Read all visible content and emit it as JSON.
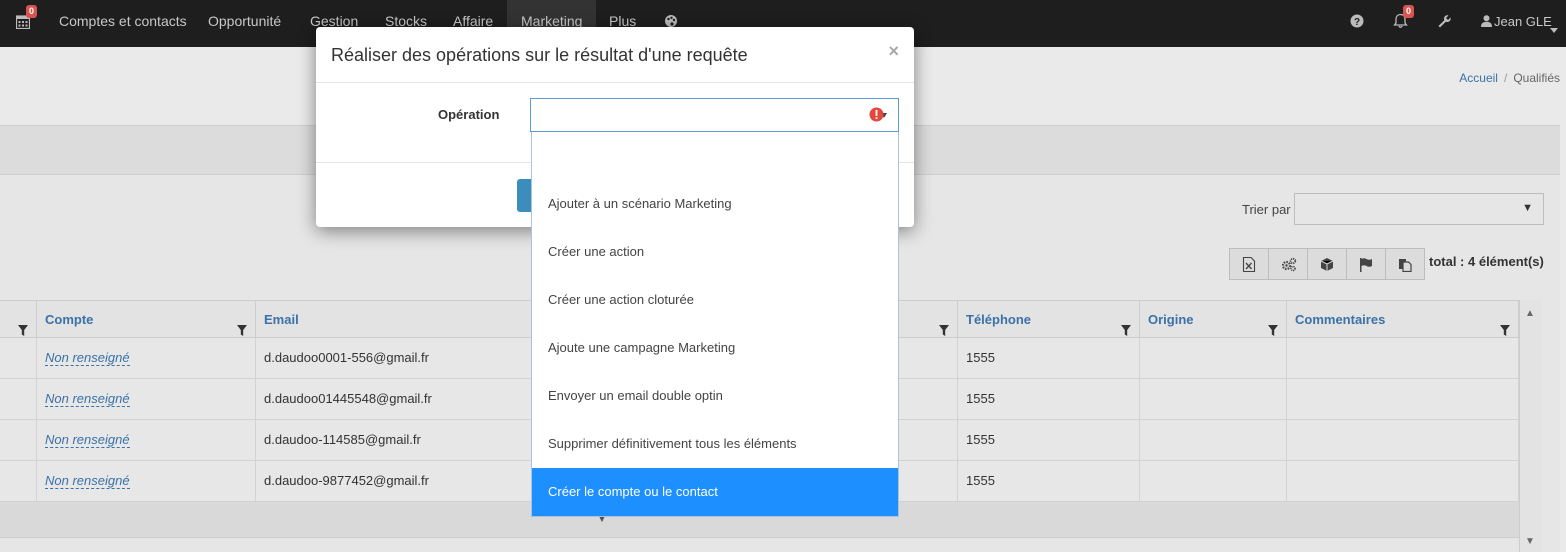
{
  "nav": {
    "calendar_badge": "0",
    "items": [
      "Comptes et contacts",
      "Opportunité",
      "Gestion",
      "Stocks",
      "Affaire",
      "Marketing",
      "Plus"
    ],
    "notifications_badge": "0",
    "user": "Jean GLE"
  },
  "breadcrumb": {
    "home": "Accueil",
    "current": "Qualifiés"
  },
  "toolbar": {
    "sort_label": "Trier par",
    "total": "total : 4 élément(s)"
  },
  "table": {
    "headers": {
      "compte": "Compte",
      "email": "Email",
      "telephone": "Téléphone",
      "origine": "Origine",
      "commentaires": "Commentaires"
    },
    "rows": [
      {
        "compte": "Non renseigné",
        "email": "d.daudoo0001-556@gmail.fr",
        "telephone": "1555"
      },
      {
        "compte": "Non renseigné",
        "email": "d.daudoo01445548@gmail.fr",
        "telephone": "1555"
      },
      {
        "compte": "Non renseigné",
        "email": "d.daudoo-114585@gmail.fr",
        "telephone": "1555"
      },
      {
        "compte": "Non renseigné",
        "email": "d.daudoo-9877452@gmail.fr",
        "telephone": "1555"
      }
    ]
  },
  "modal": {
    "title": "Réaliser des opérations sur le résultat d'une requête",
    "close": "×",
    "operation_label": "Opération",
    "options": [
      "",
      "Ajouter à un scénario Marketing",
      "Créer une action",
      "Créer une action cloturée",
      "Ajoute une campagne Marketing",
      "Envoyer un email double optin",
      "Supprimer définitivement tous les éléments",
      "Créer le compte ou le contact"
    ],
    "selected_option_index": 7
  },
  "colors": {
    "accent": "#3a72a8",
    "selected": "#1e8fff",
    "navbar": "#1e1e1e",
    "error": "#e2483d"
  }
}
